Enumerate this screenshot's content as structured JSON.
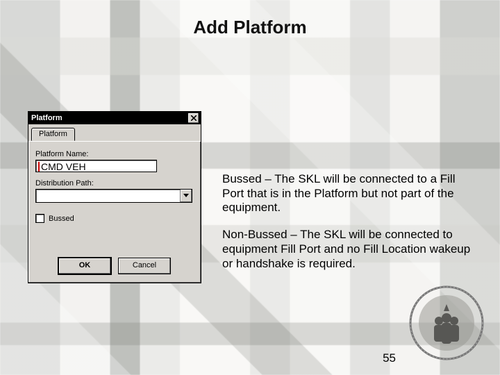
{
  "title": "Add Platform",
  "dialog": {
    "title": "Platform",
    "tab_label": "Platform",
    "name_label": "Platform Name:",
    "name_value": "CMD VEH",
    "dist_label": "Distribution Path:",
    "dist_value": "",
    "bussed_label": "Bussed",
    "bussed_checked": false,
    "ok_label": "OK",
    "cancel_label": "Cancel"
  },
  "explain": {
    "p1": "Bussed – The SKL will be connected to a Fill Port that is in the Platform but not part of the equipment.",
    "p2": "Non-Bussed – The SKL will be connected to equipment Fill Port and no Fill Location wakeup or handshake is required."
  },
  "page_number": "55",
  "icons": {
    "close": "close-icon",
    "dropdown": "chevron-down-icon"
  },
  "colors": {
    "win_gray": "#d6d3ce",
    "title_black": "#000000"
  }
}
